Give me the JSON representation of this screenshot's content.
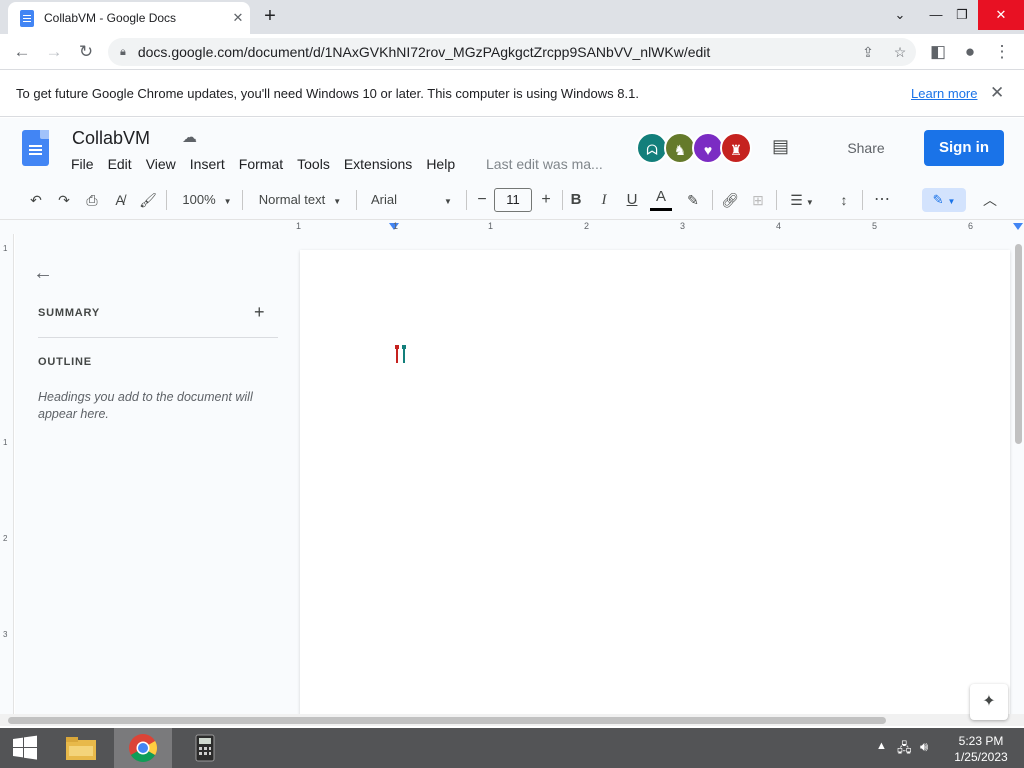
{
  "browser": {
    "tab_title": "CollabVM - Google Docs",
    "new_tab": "+",
    "url": "docs.google.com/document/d/1NAxGVKhNI72rov_MGzPAgkgctZrcpp9SANbVV_nlWKw/edit"
  },
  "infobar": {
    "message": "To get future Google Chrome updates, you'll need Windows 10 or later. This computer is using Windows 8.1.",
    "learn_more": "Learn more"
  },
  "docs": {
    "title": "CollabVM",
    "menu": [
      "File",
      "Edit",
      "View",
      "Insert",
      "Format",
      "Tools",
      "Extensions",
      "Help"
    ],
    "last_edit": "Last edit was ma...",
    "share": "Share",
    "sign_in": "Sign in",
    "colors": {
      "accent": "#1a73e8",
      "brand": "#4285f4"
    },
    "avatars": [
      {
        "icon": "avatar-ghost-icon",
        "color": "#137f7b"
      },
      {
        "icon": "avatar-cat-icon",
        "color": "#657a2b"
      },
      {
        "icon": "avatar-fox-icon",
        "color": "#7b2cc3"
      },
      {
        "icon": "avatar-monster-icon",
        "color": "#c5221f"
      }
    ]
  },
  "toolbar": {
    "zoom": "100%",
    "style": "Normal text",
    "font": "Arial",
    "font_size": "11",
    "minus": "−",
    "plus": "+",
    "bold": "B",
    "italic": "I",
    "underline": "U",
    "text_color": "A",
    "more": "⋯"
  },
  "ruler": {
    "labels": [
      "1",
      "1",
      "1",
      "2",
      "3",
      "4",
      "5",
      "6"
    ]
  },
  "vruler": {
    "labels": [
      "1",
      "1",
      "2",
      "3"
    ]
  },
  "outline": {
    "summary": "SUMMARY",
    "outline": "OUTLINE",
    "hint": "Headings you add to the document will appear here."
  },
  "taskbar": {
    "time": "5:23 PM",
    "date": "1/25/2023"
  }
}
